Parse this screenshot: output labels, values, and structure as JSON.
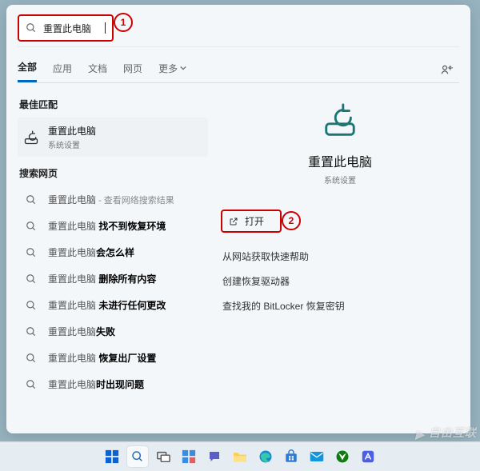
{
  "annotations": {
    "badge1": "1",
    "badge2": "2"
  },
  "search": {
    "value": "重置此电脑"
  },
  "tabs": [
    "全部",
    "应用",
    "文档",
    "网页",
    "更多"
  ],
  "active_tab_index": 0,
  "sections": {
    "best_match": "最佳匹配",
    "web": "搜索网页"
  },
  "best_match": {
    "title": "重置此电脑",
    "subtitle": "系统设置"
  },
  "web_results": [
    {
      "prefix": "重置此电脑",
      "suffix_plain": " - 查看网络搜索结果",
      "bold": ""
    },
    {
      "prefix": "重置此电脑 ",
      "bold": "找不到恢复环境"
    },
    {
      "prefix": "重置此电脑",
      "bold": "会怎么样"
    },
    {
      "prefix": "重置此电脑 ",
      "bold": "删除所有内容"
    },
    {
      "prefix": "重置此电脑 ",
      "bold": "未进行任何更改"
    },
    {
      "prefix": "重置此电脑",
      "bold": "失败"
    },
    {
      "prefix": "重置此电脑 ",
      "bold": "恢复出厂设置"
    },
    {
      "prefix": "重置此电脑",
      "bold": "时出现问题"
    }
  ],
  "detail": {
    "title": "重置此电脑",
    "subtitle": "系统设置",
    "open_label": "打开",
    "actions": [
      "从网站获取快速帮助",
      "创建恢复驱动器",
      "查找我的 BitLocker 恢复密钥"
    ]
  },
  "watermark": "自由互联",
  "taskbar_items": [
    "start",
    "search",
    "taskview",
    "widgets",
    "chat",
    "explorer",
    "edge",
    "store",
    "mail",
    "xbox",
    "app"
  ]
}
